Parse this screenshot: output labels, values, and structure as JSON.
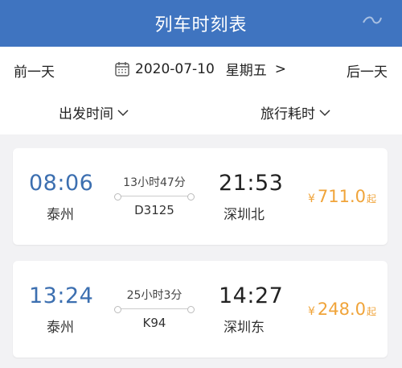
{
  "header": {
    "title": "列车时刻表"
  },
  "datebar": {
    "prev_label": "前一天",
    "date": "2020-07-10",
    "weekday": "星期五",
    "chevron": ">",
    "next_label": "后一天"
  },
  "sortbar": {
    "departure_label": "出发时间",
    "duration_label": "旅行耗时"
  },
  "trains": [
    {
      "dep_time": "08:06",
      "dep_station": "泰州",
      "duration": "13小时47分",
      "train_no": "D3125",
      "arr_time": "21:53",
      "arr_station": "深圳北",
      "currency": "¥",
      "price": "711.0",
      "price_suffix": "起"
    },
    {
      "dep_time": "13:24",
      "dep_station": "泰州",
      "duration": "25小时3分",
      "train_no": "K94",
      "arr_time": "14:27",
      "arr_station": "深圳东",
      "currency": "¥",
      "price": "248.0",
      "price_suffix": "起"
    }
  ],
  "colors": {
    "header_bg": "#3f74c0",
    "departure_time": "#3c6fb0",
    "price": "#f0a43a"
  }
}
